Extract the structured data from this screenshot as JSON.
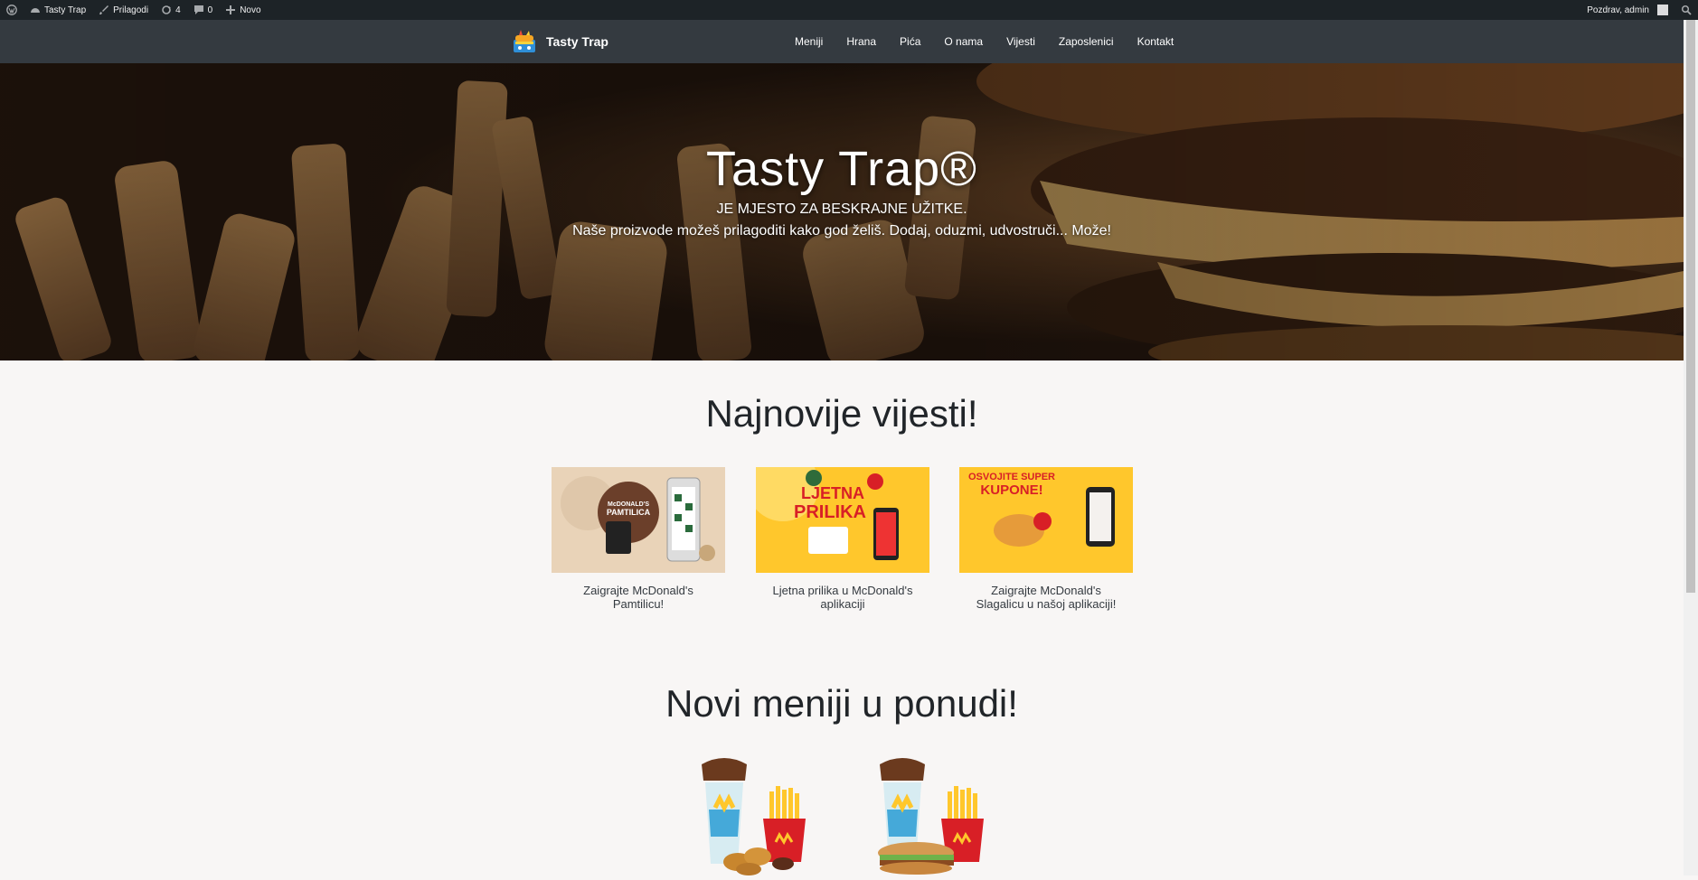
{
  "adminbar": {
    "site": "Tasty Trap",
    "customize": "Prilagodi",
    "updates": "4",
    "comments": "0",
    "new": "Novo",
    "greeting": "Pozdrav, admin"
  },
  "nav": {
    "brand": "Tasty Trap",
    "items": [
      "Meniji",
      "Hrana",
      "Pića",
      "O nama",
      "Vijesti",
      "Zaposlenici",
      "Kontakt"
    ]
  },
  "hero": {
    "title": "Tasty Trap®",
    "subtitle": "JE MJESTO ZA BESKRAJNE UŽITKE.",
    "text": "Naše proizvode možeš prilagoditi kako god želiš. Dodaj, oduzmi, udvostruči... Može!"
  },
  "news": {
    "title": "Najnovije vijesti!",
    "items": [
      {
        "caption": "Zaigrajte McDonald's Pamtilicu!",
        "img_text": [
          "McDONALD'S",
          "PAMTILICA"
        ]
      },
      {
        "caption": "Ljetna prilika u McDonald's aplikaciji",
        "img_text": [
          "LJETNA",
          "PRILIKA"
        ]
      },
      {
        "caption": "Zaigrajte McDonald's Slagalicu u našoj aplikaciji!",
        "img_text": [
          "OSVOJITE SUPER",
          "KUPONE!"
        ]
      }
    ]
  },
  "menus": {
    "title": "Novi meniji u ponudi!"
  },
  "colors": {
    "adminbar": "#1d2327",
    "nav": "#343a40",
    "page_bg": "#f8f6f5",
    "promo_yellow": "#ffc72c"
  }
}
